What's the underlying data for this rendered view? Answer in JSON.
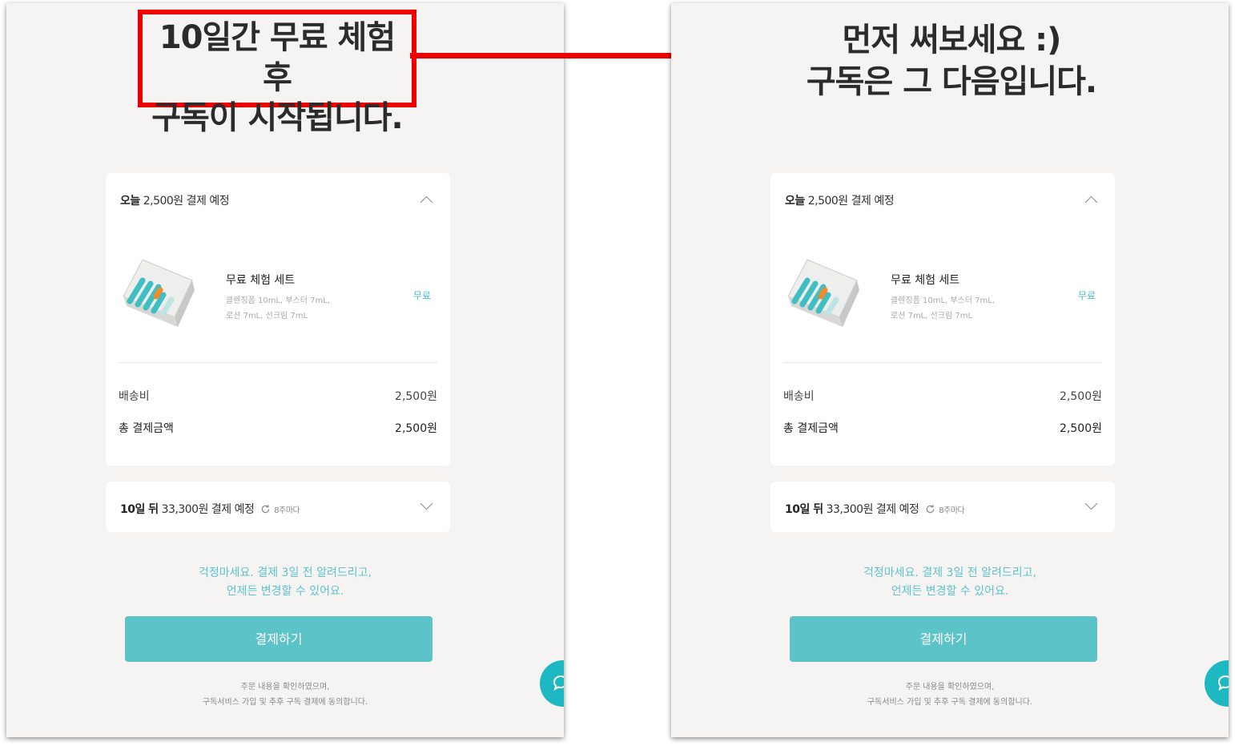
{
  "left": {
    "headline_lines": [
      "10일간 무료 체험 후",
      "구독이 시작됩니다."
    ]
  },
  "right": {
    "headline_lines": [
      "먼저 써보세요 :)",
      "구독은 그 다음입니다."
    ]
  },
  "order": {
    "today_label": "오늘",
    "today_text": "2,500원 결제 예정",
    "product_name": "무료 체험 세트",
    "product_desc_line1": "클렌징폼 10mL, 부스터 7mL,",
    "product_desc_line2": "로션 7mL, 선크림 7mL",
    "product_price": "무료",
    "shipping_label": "배송비",
    "shipping_value": "2,500원",
    "total_label": "총 결제금액",
    "total_value": "2,500원",
    "later_label": "10일 뒤",
    "later_text": "33,300원 결제 예정",
    "cycle_text": "8주마다",
    "notice_line1": "걱정마세요. 결제 3일 전 알려드리고,",
    "notice_line2": "언제든 변경할 수 있어요.",
    "pay_button": "결제하기",
    "footnote_line1": "주문 내용을 확인하였으며,",
    "footnote_line2": "구독서비스 가입 및 추후 구독 결제에 동의합니다."
  },
  "colors": {
    "accent": "#5cc3c9",
    "highlight_border": "#ee0000",
    "arrow": "#ee0000",
    "panel_bg": "#f5f4f2"
  },
  "icons": [
    "chevron-up-icon",
    "chevron-down-icon",
    "cycle-icon",
    "chat-icon",
    "arrow-right-icon"
  ]
}
